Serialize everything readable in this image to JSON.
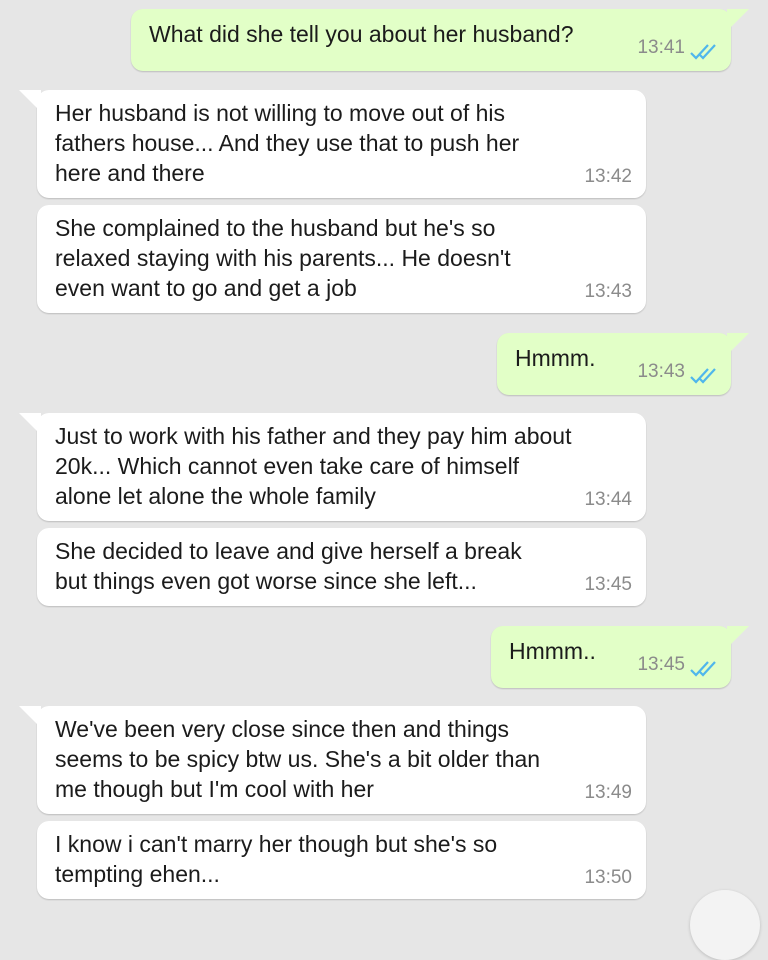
{
  "messages": [
    {
      "dir": "out",
      "text": "What did she tell you about her husband?",
      "time": "13:41",
      "status": "read"
    },
    {
      "dir": "in",
      "text": "Her husband is not willing to move out of his fathers house... And they use that to push her here and there",
      "time": "13:42"
    },
    {
      "dir": "in",
      "text": "She complained to the husband but he's so relaxed staying with his parents... He doesn't even want to go and get a job",
      "time": "13:43"
    },
    {
      "dir": "out",
      "text": "Hmmm.",
      "time": "13:43",
      "status": "read"
    },
    {
      "dir": "in",
      "text": "Just to work with his father and they pay him about 20k... Which cannot even take care of himself alone let alone the whole family",
      "time": "13:44"
    },
    {
      "dir": "in",
      "text": "She decided to leave and give herself a break but things even got worse since she left...",
      "time": "13:45"
    },
    {
      "dir": "out",
      "text": "Hmmm..",
      "time": "13:45",
      "status": "read"
    },
    {
      "dir": "in",
      "text": "We've been very close since then and things seems to be spicy btw us. She's a bit older than me though but I'm cool with her",
      "time": "13:49"
    },
    {
      "dir": "in",
      "text": "I know i can't marry her though but she's so tempting ehen...",
      "time": "13:50"
    }
  ],
  "colors": {
    "background": "#e6e6e6",
    "incoming_bubble": "#ffffff",
    "outgoing_bubble": "#e2ffc7",
    "read_ticks": "#4fb6ec",
    "timestamp": "#8b8b8b"
  },
  "icons": {
    "read_receipt": "double-check-icon"
  }
}
